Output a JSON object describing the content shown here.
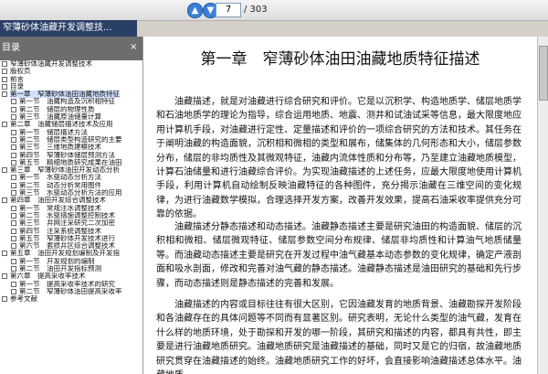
{
  "toolbar": {
    "page_current": "7",
    "page_total": "/ 303"
  },
  "tab": {
    "title": "窄薄砂体油藏开发调整技..."
  },
  "panel": {
    "title": "目录",
    "close": "×"
  },
  "bookmarks": [
    {
      "label": "窄薄砂体油藏开发调整技术",
      "level": 0
    },
    {
      "label": "版权页",
      "level": 0
    },
    {
      "label": "前言",
      "level": 0
    },
    {
      "label": "目录",
      "level": 0
    },
    {
      "label": "第一章　窄薄砂体油田油藏地质特征",
      "level": 0,
      "selected": true
    },
    {
      "label": "第一节　油藏构造及沉积相特征",
      "level": 1
    },
    {
      "label": "第二节　储层的物理性质",
      "level": 1
    },
    {
      "label": "第三节　油藏原油储量计算",
      "level": 1
    },
    {
      "label": "第二章　油藏储层描述技术及应用",
      "level": 0
    },
    {
      "label": "第一节　储层描述方法",
      "level": 1
    },
    {
      "label": "第二节　储层类型构造研究的主要",
      "level": 1
    },
    {
      "label": "第三节　三维地质建模技术",
      "level": 1
    },
    {
      "label": "第四节　窄薄砂体储层预测方法",
      "level": 1
    },
    {
      "label": "第五节　精细地质研究成果在油田",
      "level": 1
    },
    {
      "label": "第三章　窄薄砂体油田开发动态分析",
      "level": 0
    },
    {
      "label": "第一节　水驱动态分析方法",
      "level": 1
    },
    {
      "label": "第二节　动态分析常用图件",
      "level": 1
    },
    {
      "label": "第三节　水驱动态分析方法的应用",
      "level": 1
    },
    {
      "label": "第四章　油田开发综合调整技术",
      "level": 0
    },
    {
      "label": "第一节　常规注水调整技术",
      "level": 1
    },
    {
      "label": "第二节　水驱措施调整控制技术",
      "level": 1
    },
    {
      "label": "第三节　井网注采研究二次加密",
      "level": 1
    },
    {
      "label": "第四节　注采系统调整技术",
      "level": 1
    },
    {
      "label": "第五节　窄薄砂体开发技术进行",
      "level": 1
    },
    {
      "label": "第六节　套损井区综合调整技术",
      "level": 1
    },
    {
      "label": "第五章　油田开发规划编制及开发指",
      "level": 0
    },
    {
      "label": "第一节　开发规划的编制",
      "level": 1
    },
    {
      "label": "第二节　油田开发指标预测",
      "level": 1
    },
    {
      "label": "第六章　提高采收率技术",
      "level": 0
    },
    {
      "label": "第一节　提高采收率技术的研究",
      "level": 1
    },
    {
      "label": "第二节　窄薄砂体油田提高采收率",
      "level": 1
    },
    {
      "label": "参考文献",
      "level": 0
    }
  ],
  "document": {
    "title": "第一章　窄薄砂体油田油藏地质特征描述",
    "paragraphs": [
      "油藏描述，就是对油藏进行综合研究和评价。它是以沉积学、构造地质学、储层地质学和石油地质学的理论为指导，综合运用地质、地震、测井和试油试采等信息，最大限度地应用计算机手段，对油藏进行定性、定量描述和评价的一项综合研究的方法和技术。其任务在于阐明油藏的构造面貌，沉积相和微相的类型和展布，储集体的几何形态和大小，储层参数分布，储层的非均质性及其微观特征，油藏内流体性质和分布等，乃至建立油藏地质模型，计算石油储量和进行油藏综合评价。为实现油藏描述的上述任务，应最大限度地使用计算机手段，利用计算机自动绘制反映油藏特征的各种图件，充分揭示油藏在三维空间的变化规律，为进行油藏数学模拟，合理选择开发方案，改善开发效果，提高石油采收率提供充分可靠的依据。",
      "油藏描述分静态描述和动态描述。油藏静态描述主要是研究油田的构造面貌、储层的沉积相和微相、储层微观特征、储层参数空间分布规律、储层非均质性和计算油气地质储量等。而油藏动态描述主要是研究在开发过程中油气藏基本动态参数的变化规律，确定产液剖面和吸水剖面，修改和完善对油气藏的静态描述。油藏静态描述是油田研究的基础和先行步骤，而动态描述则是静态描述的完善和发展。",
      "油藏描述的内容或目标往往有很大区别，它因油藏发育的地质背景、油藏勘探开发阶段和各油藏存在的具体问题等不同而有显著区别。研究表明，无论什么类型的油气藏，发育在什么样的地质环境，处于勘探和开发的哪一阶段，其研究和描述的内容，都具有共性，即主要是进行油藏地质研究。油藏地质研究是油藏描述的基础，同时又是它的归宿，故油藏地质研究贯穿在油藏描述的始终。油藏地质研究工作的好坏，会直接影响油藏描述总体水平。油藏地质"
    ]
  }
}
